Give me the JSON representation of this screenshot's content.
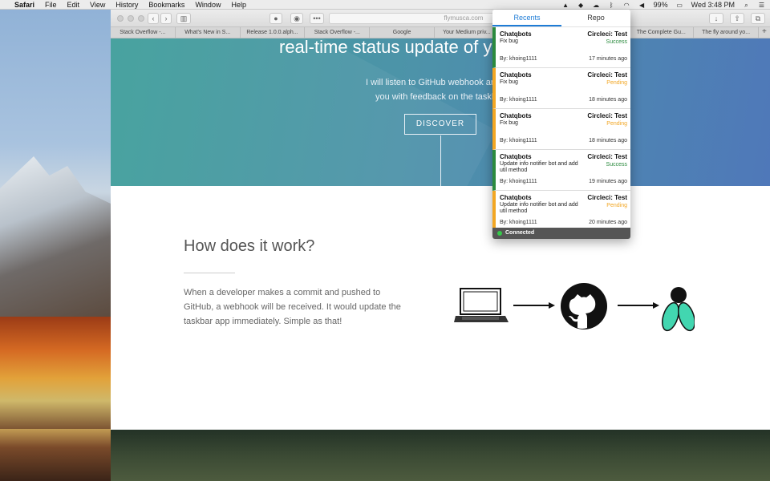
{
  "menubar": {
    "app": "Safari",
    "items": [
      "File",
      "Edit",
      "View",
      "History",
      "Bookmarks",
      "Window",
      "Help"
    ],
    "battery": "99%",
    "clock": "Wed 3:48 PM",
    "icons": [
      "fly-icon",
      "dropbox-icon",
      "cloud-icon",
      "bluetooth-icon",
      "wifi-icon",
      "volume-icon",
      "battery-icon",
      "search-icon",
      "list-icon"
    ]
  },
  "browser": {
    "url": "flymusca.com",
    "tabs": [
      "Stack Overflow -...",
      "What's New in S...",
      "Release 1.0.0.alph...",
      "Stack Overflow -...",
      "Google",
      "Your Medium priv...",
      "",
      "",
      "The Complete Gu...",
      "The fly around yo..."
    ]
  },
  "hero": {
    "title": "real-time status update of yo",
    "subtitle_line1": "I will listen to GitHub webhook and p",
    "subtitle_line2": "you with feedback on the taskbar",
    "button": "DISCOVER"
  },
  "how": {
    "title": "How does it work?",
    "text": "When a developer makes a commit and pushed to GitHub, a webhook will be received. It would update the taskbar app immediately. Simple as that!"
  },
  "popover": {
    "tabs": [
      "Recents",
      "Repo"
    ],
    "items": [
      {
        "repo": "Chatqbots",
        "ci": "Circleci: Test",
        "message": "Fix bug",
        "status": "Success",
        "by": "By: khoing1111",
        "time": "17 minutes ago",
        "state": "success"
      },
      {
        "repo": "Chatqbots",
        "ci": "Circleci: Test",
        "message": "Fix bug",
        "status": "Pending",
        "by": "By: khoing1111",
        "time": "18 minutes ago",
        "state": "pending"
      },
      {
        "repo": "Chatqbots",
        "ci": "Circleci: Test",
        "message": "Fix bug",
        "status": "Pending",
        "by": "By: khoing1111",
        "time": "18 minutes ago",
        "state": "pending"
      },
      {
        "repo": "Chatqbots",
        "ci": "Circleci: Test",
        "message": "Update info notifier bot and add util method",
        "status": "Success",
        "by": "By: khoing1111",
        "time": "19 minutes ago",
        "state": "success"
      },
      {
        "repo": "Chatqbots",
        "ci": "Circleci: Test",
        "message": "Update info notifier bot and add util method",
        "status": "Pending",
        "by": "By: khoing1111",
        "time": "20 minutes ago",
        "state": "pending"
      }
    ],
    "footer": "Connected"
  },
  "colors": {
    "success": "#2b8a3e",
    "pending": "#f2a623",
    "accent": "#1e7cd6"
  }
}
